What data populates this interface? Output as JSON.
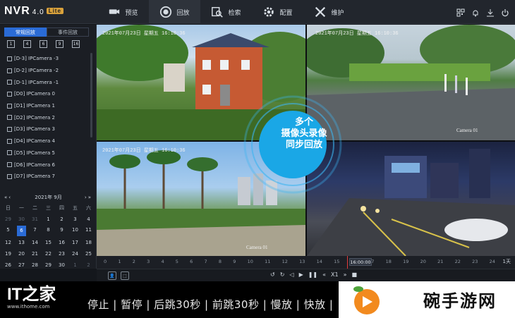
{
  "app": {
    "name": "NVR",
    "version": "4.0",
    "edition": "Lite"
  },
  "nav": [
    {
      "label": "预览",
      "icon": "camera-icon"
    },
    {
      "label": "回放",
      "icon": "playback-icon",
      "active": true
    },
    {
      "label": "检索",
      "icon": "search-icon"
    },
    {
      "label": "配置",
      "icon": "gear-icon"
    },
    {
      "label": "维护",
      "icon": "tools-icon"
    }
  ],
  "sidebar": {
    "tabs": [
      "常规回放",
      "事件回放"
    ],
    "split_options": [
      "1",
      "4",
      "6",
      "9",
      "16"
    ],
    "cameras": [
      "[D-3] IPCamera -3",
      "[D-2] IPCamera -2",
      "[D-1] IPCamera -1",
      "[D0] IPCamera 0",
      "[D1] IPCamera 1",
      "[D2] IPCamera 2",
      "[D3] IPCamera 3",
      "[D4] IPCamera 4",
      "[D5] IPCamera 5",
      "[D6] IPCamera 6",
      "[D7] IPCamera 7"
    ]
  },
  "calendar": {
    "title": "2021年 9月",
    "weekdays": [
      "日",
      "一",
      "二",
      "三",
      "四",
      "五",
      "六"
    ],
    "days": [
      [
        "29",
        "30",
        "31",
        "1",
        "2",
        "3",
        "4"
      ],
      [
        "5",
        "6",
        "7",
        "8",
        "9",
        "10",
        "11"
      ],
      [
        "12",
        "13",
        "14",
        "15",
        "16",
        "17",
        "18"
      ],
      [
        "19",
        "20",
        "21",
        "22",
        "23",
        "24",
        "25"
      ],
      [
        "26",
        "27",
        "28",
        "29",
        "30",
        "1",
        "2"
      ]
    ],
    "selected": "6"
  },
  "video": {
    "osd_top_left": "2021年07月23日 星期五 16:10:36",
    "osd_top_right": "2021年07月23日 星期五 16:10:36",
    "osd_bottom_left": "2021年07月23日 星期五 16:10:36",
    "cam_label_top_right": "Camera 01",
    "cam_label_bottom_left": "Camera 01",
    "badge_lines": [
      "多个",
      "摄像头录像",
      "同步回放"
    ]
  },
  "timeline": {
    "ticks": [
      "0",
      "1",
      "2",
      "3",
      "4",
      "5",
      "6",
      "7",
      "8",
      "9",
      "10",
      "11",
      "12",
      "13",
      "14",
      "15",
      "16",
      "17",
      "18",
      "19",
      "20",
      "21",
      "22",
      "23",
      "24"
    ],
    "current_time": "16:00:00",
    "range_label": "1天"
  },
  "controls": {
    "speed": "X1"
  },
  "banner": {
    "brand": "IT之家",
    "url": "www.ithome.com",
    "caption": "停止 | 暂停 | 后跳30秒 | 前跳30秒 | 慢放 | 快放 |",
    "watermark": "碗手游网"
  }
}
